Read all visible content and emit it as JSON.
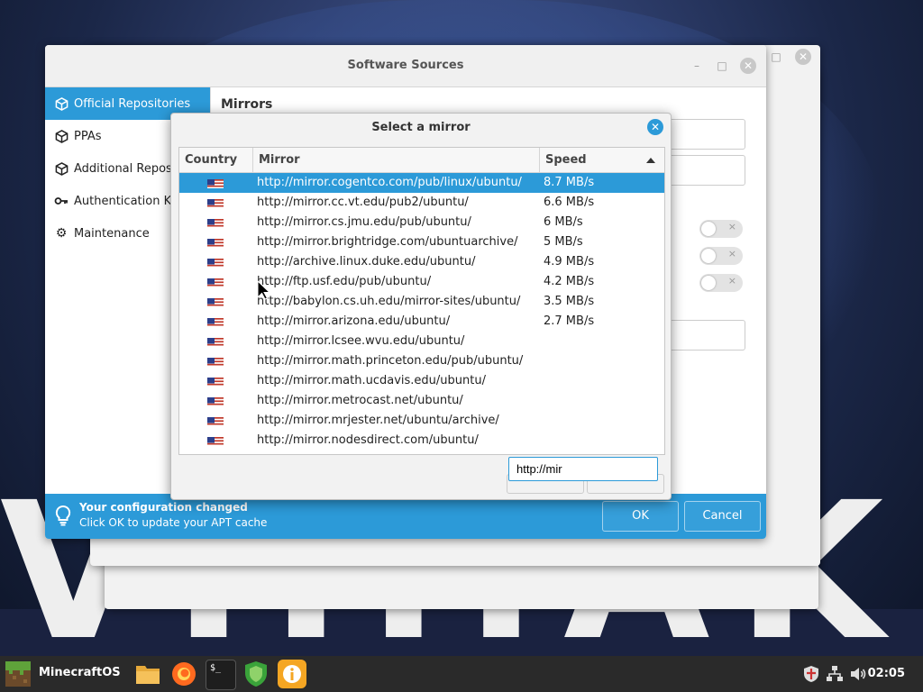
{
  "main_window": {
    "title": "Software Sources",
    "content_heading": "Mirrors",
    "sidebar": [
      {
        "label": "Official Repositories",
        "icon": "package-icon",
        "active": true
      },
      {
        "label": "PPAs",
        "icon": "package-icon",
        "active": false
      },
      {
        "label": "Additional Repositories",
        "icon": "package-icon",
        "active": false
      },
      {
        "label": "Authentication Keys",
        "icon": "key-icon",
        "active": false
      },
      {
        "label": "Maintenance",
        "icon": "gear-icon",
        "active": false
      }
    ],
    "info_bar": {
      "title": "Your configuration changed",
      "subtitle": "Click OK to update your APT cache",
      "ok_label": "OK",
      "cancel_label": "Cancel"
    }
  },
  "dialog": {
    "title": "Select a mirror",
    "columns": {
      "country": "Country",
      "mirror": "Mirror",
      "speed": "Speed"
    },
    "sort": {
      "column": "speed",
      "direction": "descending"
    },
    "rows": [
      {
        "country": "US",
        "mirror": "http://mirror.cogentco.com/pub/linux/ubuntu/",
        "speed": "8.7 MB/s",
        "selected": true
      },
      {
        "country": "US",
        "mirror": "http://mirror.cc.vt.edu/pub2/ubuntu/",
        "speed": "6.6 MB/s"
      },
      {
        "country": "US",
        "mirror": "http://mirror.cs.jmu.edu/pub/ubuntu/",
        "speed": "6 MB/s"
      },
      {
        "country": "US",
        "mirror": "http://mirror.brightridge.com/ubuntuarchive/",
        "speed": "5 MB/s"
      },
      {
        "country": "US",
        "mirror": "http://archive.linux.duke.edu/ubuntu/",
        "speed": "4.9 MB/s"
      },
      {
        "country": "US",
        "mirror": "http://ftp.usf.edu/pub/ubuntu/",
        "speed": "4.2 MB/s"
      },
      {
        "country": "US",
        "mirror": "http://babylon.cs.uh.edu/mirror-sites/ubuntu/",
        "speed": "3.5 MB/s"
      },
      {
        "country": "US",
        "mirror": "http://mirror.arizona.edu/ubuntu/",
        "speed": "2.7 MB/s"
      },
      {
        "country": "US",
        "mirror": "http://mirror.lcsee.wvu.edu/ubuntu/",
        "speed": ""
      },
      {
        "country": "US",
        "mirror": "http://mirror.math.princeton.edu/pub/ubuntu/",
        "speed": ""
      },
      {
        "country": "US",
        "mirror": "http://mirror.math.ucdavis.edu/ubuntu/",
        "speed": ""
      },
      {
        "country": "US",
        "mirror": "http://mirror.metrocast.net/ubuntu/",
        "speed": ""
      },
      {
        "country": "US",
        "mirror": "http://mirror.mrjester.net/ubuntu/archive/",
        "speed": ""
      },
      {
        "country": "US",
        "mirror": "http://mirror.nodesdirect.com/ubuntu/",
        "speed": ""
      }
    ],
    "search_value": "http://mir"
  },
  "taskbar": {
    "menu_label": "MinecraftOS",
    "apps": [
      "file-manager-icon",
      "firefox-icon",
      "terminal-icon",
      "shield-icon",
      "info-icon"
    ],
    "tray": [
      "shield-tray-icon",
      "network-icon",
      "volume-icon"
    ],
    "clock": "02:05"
  },
  "colors": {
    "accent": "#2c9ad8",
    "taskbar": "#2a2a2a"
  }
}
